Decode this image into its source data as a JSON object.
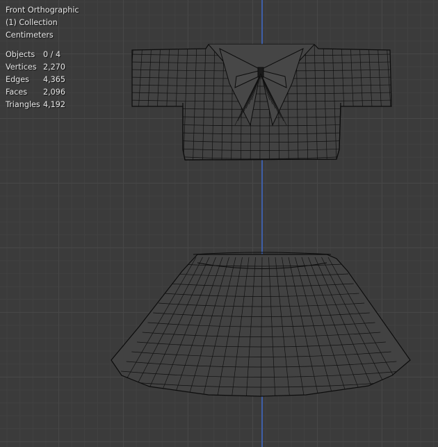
{
  "viewport": {
    "view_name": "Front Orthographic",
    "collection": "(1) Collection",
    "units": "Centimeters"
  },
  "stats": [
    {
      "label": "Objects",
      "value": "0 / 4"
    },
    {
      "label": "Vertices",
      "value": "2,270"
    },
    {
      "label": "Edges",
      "value": "4,365"
    },
    {
      "label": "Faces",
      "value": "2,096"
    },
    {
      "label": "Triangles",
      "value": "4,192"
    }
  ],
  "colors": {
    "background": "#3b3b3b",
    "grid": "#474747",
    "axis_z": "#3f5fa8",
    "wireframe": "#0c0c0c",
    "mesh_fill": "#424242"
  },
  "objects": [
    "shirt-mesh",
    "skirt-mesh"
  ]
}
